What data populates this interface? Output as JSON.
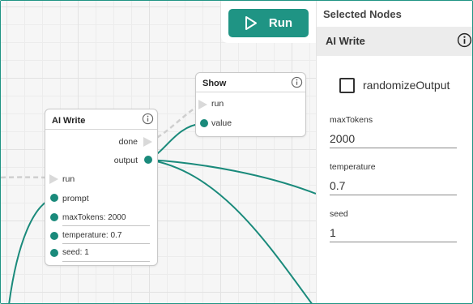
{
  "toolbar": {
    "run_label": "Run"
  },
  "nodes": {
    "show": {
      "title": "Show",
      "inputs": [
        "run",
        "value"
      ]
    },
    "ai_write": {
      "title": "AI Write",
      "outputs": [
        "done",
        "output"
      ],
      "inputs": [
        "run",
        "prompt"
      ],
      "params": [
        "maxTokens: 2000",
        "temperature: 0.7",
        "seed: 1"
      ]
    }
  },
  "panel": {
    "title": "Selected Nodes",
    "node_name": "AI Write",
    "checkbox": {
      "label": "randomizeOutput",
      "checked": false
    },
    "fields": [
      {
        "label": "maxTokens",
        "value": "2000"
      },
      {
        "label": "temperature",
        "value": "0.7"
      },
      {
        "label": "seed",
        "value": "1"
      }
    ]
  },
  "colors": {
    "accent": "#1f9484",
    "port": "#1a8a7b",
    "canvas_bg": "#f6f6f6",
    "panel_header_bg": "#ececec"
  },
  "icons": {
    "run": "play-icon",
    "info": "info-icon"
  }
}
